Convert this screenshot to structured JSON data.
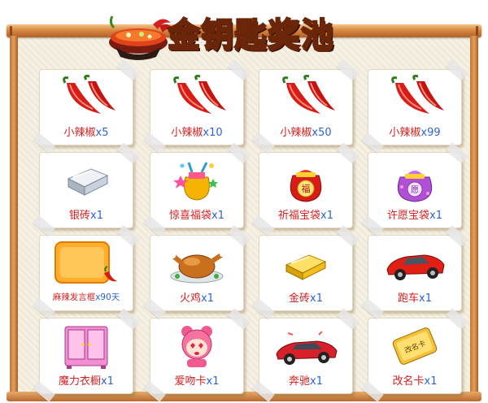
{
  "header": {
    "title": "金钥匙奖池",
    "icon": "hot-pot-icon"
  },
  "colors": {
    "name": "#d41f1f",
    "quantity": "#2b63d6",
    "frame": "#c07636",
    "board": "#f6f0e2"
  },
  "rewards": [
    {
      "name": "小辣椒",
      "qty": "x5",
      "icon": "chili-pepper-icon"
    },
    {
      "name": "小辣椒",
      "qty": "x10",
      "icon": "chili-pepper-icon"
    },
    {
      "name": "小辣椒",
      "qty": "x50",
      "icon": "chili-pepper-icon"
    },
    {
      "name": "小辣椒",
      "qty": "x99",
      "icon": "chili-pepper-icon"
    },
    {
      "name": "银砖",
      "qty": "x1",
      "icon": "silver-brick-icon"
    },
    {
      "name": "惊喜福袋",
      "qty": "x1",
      "icon": "surprise-bag-icon"
    },
    {
      "name": "祈福宝袋",
      "qty": "x1",
      "icon": "blessing-bag-icon",
      "badge": "福"
    },
    {
      "name": "许愿宝袋",
      "qty": "x1",
      "icon": "wish-bag-icon",
      "badge": "愿"
    },
    {
      "name": "麻辣发言框",
      "qty": "x90天",
      "icon": "chat-frame-icon"
    },
    {
      "name": "火鸡",
      "qty": "x1",
      "icon": "roast-turkey-icon"
    },
    {
      "name": "金砖",
      "qty": "x1",
      "icon": "gold-brick-icon"
    },
    {
      "name": "跑车",
      "qty": "x1",
      "icon": "sports-car-icon"
    },
    {
      "name": "魔力衣橱",
      "qty": "x1",
      "icon": "wardrobe-icon"
    },
    {
      "name": "爱吻卡",
      "qty": "x1",
      "icon": "kiss-card-icon"
    },
    {
      "name": "奔驰",
      "qty": "x1",
      "icon": "benz-car-icon"
    },
    {
      "name": "改名卡",
      "qty": "x1",
      "icon": "rename-card-icon",
      "badge": "改名卡"
    }
  ]
}
